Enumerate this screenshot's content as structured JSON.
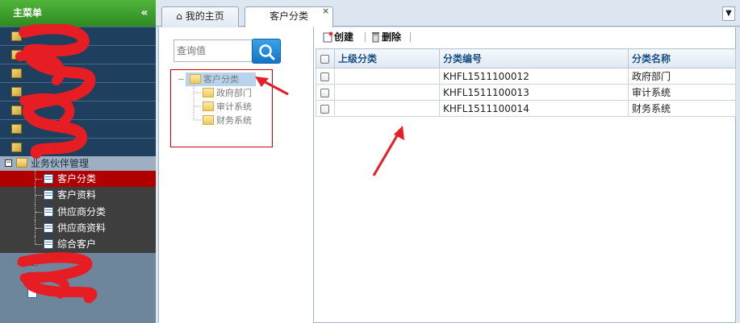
{
  "sidebar": {
    "title": "主菜单",
    "collapse_icon": "double-chevron-left-icon",
    "group": {
      "label": "业务伙伴管理",
      "toggle": "−",
      "items": [
        {
          "label": "客户分类",
          "active": true
        },
        {
          "label": "客户资料",
          "active": false
        },
        {
          "label": "供应商分类",
          "active": false
        },
        {
          "label": "供应商资料",
          "active": false
        },
        {
          "label": "综合客户",
          "active": false
        }
      ]
    }
  },
  "tabs": [
    {
      "label": "我的主页",
      "icon": "home-icon"
    },
    {
      "label": "客户分类",
      "active": true
    }
  ],
  "tab_close": "×",
  "tab_menu_icon": "double-chevron-down-icon",
  "search": {
    "placeholder": "查询值",
    "button_icon": "search-icon"
  },
  "tree": {
    "root": {
      "label": "客户分类",
      "toggle": "−"
    },
    "children": [
      {
        "label": "政府部门"
      },
      {
        "label": "审计系统"
      },
      {
        "label": "财务系统"
      }
    ]
  },
  "toolbar": {
    "create_label": "创建",
    "delete_label": "删除"
  },
  "grid": {
    "columns": [
      "上级分类",
      "分类编号",
      "分类名称"
    ],
    "rows": [
      {
        "parent": "",
        "code": "KHFL1511100012",
        "name": "政府部门"
      },
      {
        "parent": "",
        "code": "KHFL1511100013",
        "name": "审计系统"
      },
      {
        "parent": "",
        "code": "KHFL1511100014",
        "name": "财务系统"
      }
    ]
  },
  "colors": {
    "header_green": "#3a9a2c",
    "active_red": "#b10000",
    "nav_dark": "#1f3f5e",
    "grid_header_text": "#1a4f86"
  }
}
